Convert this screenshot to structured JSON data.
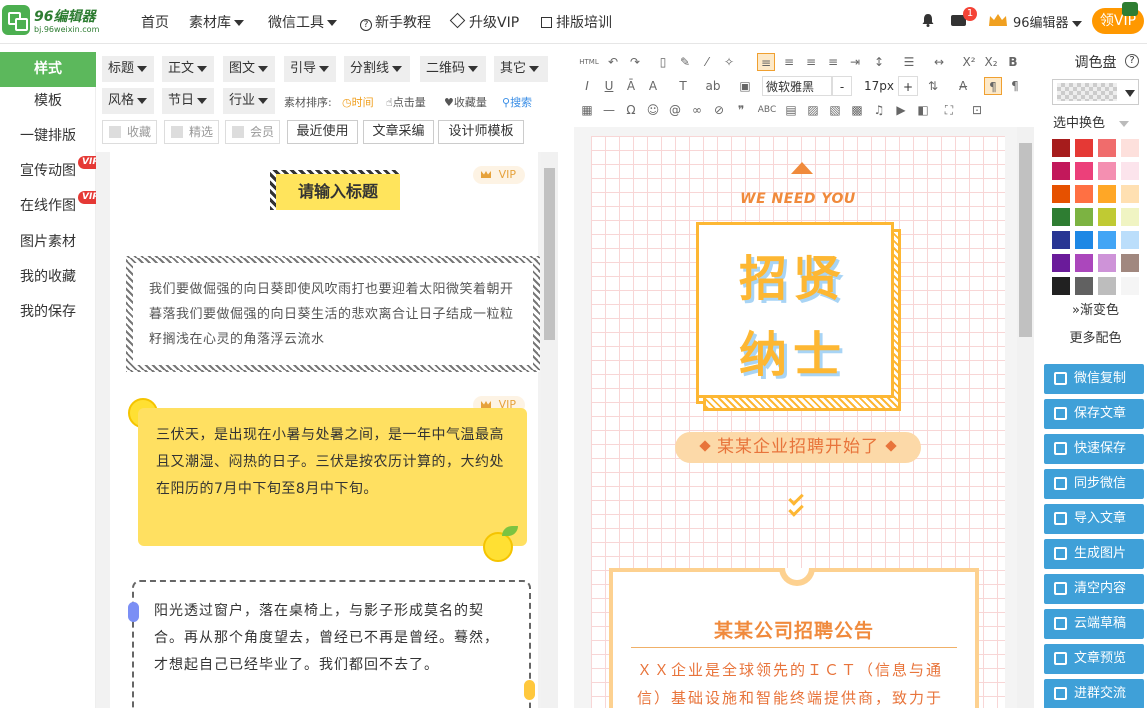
{
  "header": {
    "logo_title": "96编辑器",
    "logo_sub": "bj.96weixin.com",
    "nav": [
      "首页",
      "素材库",
      "微信工具",
      "新手教程",
      "升级VIP",
      "排版培训"
    ],
    "mail_count": "1",
    "user_name": "96编辑器",
    "vip_button": "领VIP"
  },
  "left_menu": {
    "items": [
      "样式",
      "模板",
      "一键排版",
      "宣传动图",
      "在线作图",
      "图片素材",
      "我的收藏",
      "我的保存"
    ],
    "vip_badge": "VIP"
  },
  "filters": {
    "row1": [
      "标题",
      "正文",
      "图文",
      "引导",
      "分割线",
      "二维码",
      "其它"
    ],
    "row2": [
      "风格",
      "节日",
      "行业"
    ],
    "sort_label": "素材排序:",
    "sort_options": [
      "时间",
      "点击量",
      "收藏量",
      "搜索"
    ],
    "checks": [
      "收藏",
      "精选",
      "会员"
    ],
    "buttons": [
      "最近使用",
      "文章采编",
      "设计师模板"
    ]
  },
  "materials": {
    "vip_label": "VIP",
    "card1_title": "请输入标题",
    "card2_text": "我们要做倔强的向日葵即使风吹雨打也要迎着太阳微笑着朝开暮落我们要做倔强的向日葵生活的悲欢离合让日子结成一粒粒籽搁浅在心灵的角落浮云流水",
    "card3_text": "三伏天，是出现在小暑与处暑之间，是一年中气温最高且又潮湿、闷热的日子。三伏是按农历计算的，大约处在阳历的7月中下旬至8月中下旬。",
    "card4_text": "阳光透过窗户，落在桌椅上，与影子形成莫名的契合。再从那个角度望去，曾经已不再是曾经。蓦然，才想起自己已经毕业了。我们都回不去了。"
  },
  "toolbar": {
    "font_family": "微软雅黑",
    "font_size": "17px",
    "minus": "-",
    "plus": "+"
  },
  "editor": {
    "we_need": "WE NEED YOU",
    "char1": "招贤",
    "char2": "纳士",
    "ribbon": "某某企业招聘开始了",
    "notice_title": "某某公司招聘公告",
    "notice_body": "ＸＸ企业是全球领先的ＩＣＴ（信息与通信）基础设施和智能终端提供商，致力于"
  },
  "palette": {
    "title": "调色盘",
    "select_label": "选中换色",
    "gradient": "渐变色",
    "more": "更多配色",
    "colors": [
      [
        "#a61c1c",
        "#e53935",
        "#f06c6c",
        "#fde0dc"
      ],
      [
        "#c2185b",
        "#ec407a",
        "#f48fb1",
        "#fce4ec"
      ],
      [
        "#e65100",
        "#ff7043",
        "#ffa726",
        "#ffe0b2"
      ],
      [
        "#2e7d32",
        "#7cb342",
        "#c0ca33",
        "#f0f4c3"
      ],
      [
        "#283593",
        "#1e88e5",
        "#42a5f5",
        "#bbdefb"
      ],
      [
        "#6a1b9a",
        "#ab47bc",
        "#ce93d8",
        "#a1887f"
      ],
      [
        "#212121",
        "#616161",
        "#bdbdbd",
        "#f5f5f5"
      ]
    ]
  },
  "actions": [
    "微信复制",
    "保存文章",
    "快速保存",
    "同步微信",
    "导入文章",
    "生成图片",
    "清空内容",
    "云端草稿",
    "文章预览",
    "进群交流"
  ]
}
